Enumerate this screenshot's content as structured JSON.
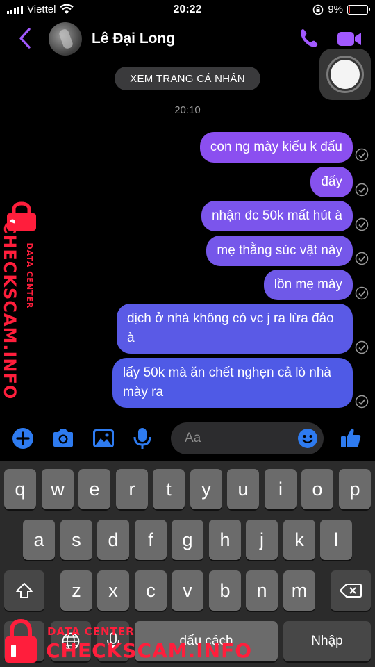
{
  "status_bar": {
    "carrier": "Viettel",
    "time": "20:22",
    "battery_percent": "9%",
    "battery_level": 0.09
  },
  "header": {
    "contact_name": "Lê Đại Long"
  },
  "profile_button": "XEM TRANG CÁ NHÂN",
  "timestamp": "20:10",
  "messages": [
    {
      "text": "con ng mày kiểu k đấu"
    },
    {
      "text": "đấy"
    },
    {
      "text": "nhận đc 50k mất hút à"
    },
    {
      "text": "mẹ thằng súc vật này"
    },
    {
      "text": "lồn mẹ mày"
    },
    {
      "text": "dịch ở nhà không có vc j ra lừa đảo à"
    },
    {
      "text": "lấy 50k mà ăn chết nghẹn cả lò nhà mày ra"
    }
  ],
  "composer": {
    "placeholder": "Aa"
  },
  "keyboard": {
    "row1": [
      "q",
      "w",
      "e",
      "r",
      "t",
      "y",
      "u",
      "i",
      "o",
      "p"
    ],
    "row2": [
      "a",
      "s",
      "d",
      "f",
      "g",
      "h",
      "j",
      "k",
      "l"
    ],
    "row3": [
      "z",
      "x",
      "c",
      "v",
      "b",
      "n",
      "m"
    ],
    "space_label": "dấu cách",
    "return_label": "Nhập"
  },
  "watermark": {
    "brand": "CHECKSCAM.INFO",
    "tagline": "DATA CENTER"
  },
  "colors": {
    "accent": "#a259ff",
    "composer_icon": "#2e7bf0",
    "watermark": "#ff1e3c"
  }
}
